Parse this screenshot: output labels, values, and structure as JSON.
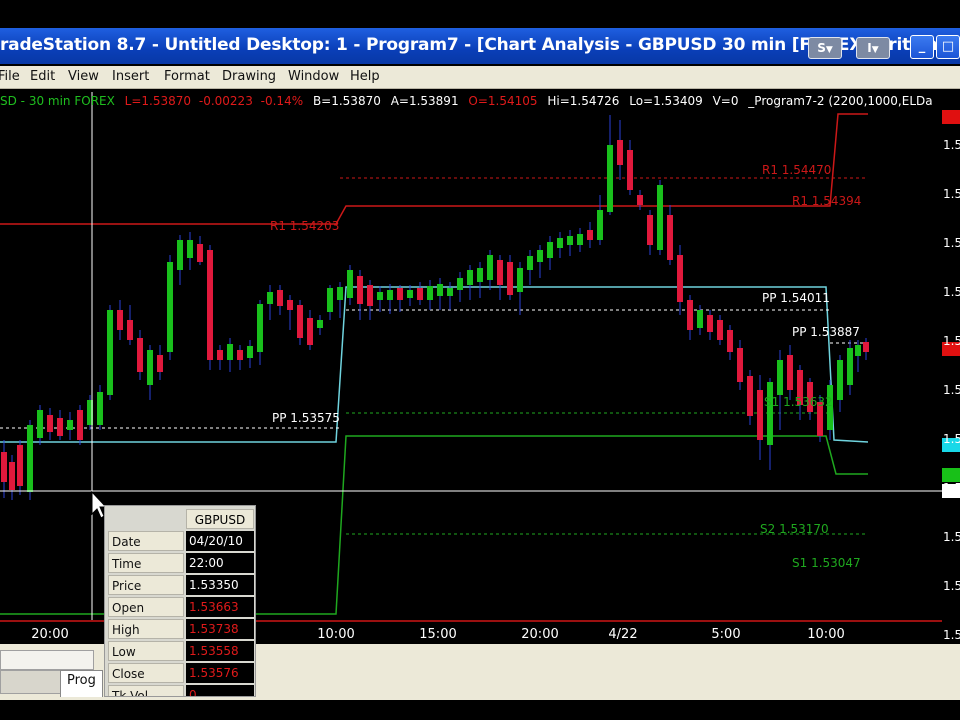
{
  "window": {
    "title": "radeStation 8.7 - Untitled Desktop: 1 - Program7 - [Chart Analysis - GBPUSD 30 min [FOREX] British P",
    "btn_s": "S",
    "btn_i": "I"
  },
  "menu": [
    "File",
    "Edit",
    "View",
    "Insert",
    "Format",
    "Drawing",
    "Window",
    "Help"
  ],
  "infoline": {
    "symbol": "SD - 30 min FOREX",
    "last": "L=1.53870",
    "change": "-0.00223",
    "pct": "-0.14%",
    "bid": "B=1.53870",
    "ask": "A=1.53891",
    "open": "O=1.54105",
    "hi": "Hi=1.54726",
    "lo": "Lo=1.53409",
    "vol": "V=0",
    "study": "_Program7-2 (2200,1000,ELDa"
  },
  "colors": {
    "up": "#19c01c",
    "down": "#e0193c",
    "r1": "#cc1818",
    "pp": "#6fd3de",
    "s": "#1fa81f",
    "crosshair": "#ffffff",
    "title_bg": "#0a3fb8",
    "menu_bg": "#ece9d8"
  },
  "levels": [
    {
      "label": "R1  1.54203",
      "color": "red"
    },
    {
      "label": "R1  1.54470",
      "color": "red"
    },
    {
      "label": "R1  1.54394",
      "color": "red"
    },
    {
      "label": "PP  1.53575",
      "color": "white"
    },
    {
      "label": "PP  1.54011",
      "color": "white"
    },
    {
      "label": "PP  1.53887",
      "color": "white"
    },
    {
      "label": "S1  1.53632",
      "color": "green"
    },
    {
      "label": "S2  1.53170",
      "color": "green"
    },
    {
      "label": "S1  1.53047",
      "color": "green"
    }
  ],
  "price_axis": [
    "1.5",
    "1.5",
    "1.5",
    "1.5",
    "1.5",
    "1.5",
    "1.5",
    "1.5",
    "1.5",
    "1.5",
    "1.5",
    "1.5"
  ],
  "time_axis": [
    "20:00",
    "10:00",
    "15:00",
    "20:00",
    "4/22",
    "5:00",
    "10:00"
  ],
  "data_window": {
    "header": "GBPUSD",
    "rows": [
      {
        "k": "Date",
        "v": "04/20/10",
        "red": false
      },
      {
        "k": "Time",
        "v": "22:00",
        "red": false
      },
      {
        "k": "Price",
        "v": "1.53350",
        "red": false
      },
      {
        "k": "Open",
        "v": "1.53663",
        "red": true
      },
      {
        "k": "High",
        "v": "1.53738",
        "red": true
      },
      {
        "k": "Low",
        "v": "1.53558",
        "red": true
      },
      {
        "k": "Close",
        "v": "1.53576",
        "red": true
      },
      {
        "k": "Tk Vol",
        "v": "0",
        "red": true
      }
    ]
  },
  "bottom": {
    "tab": "Prog"
  }
}
